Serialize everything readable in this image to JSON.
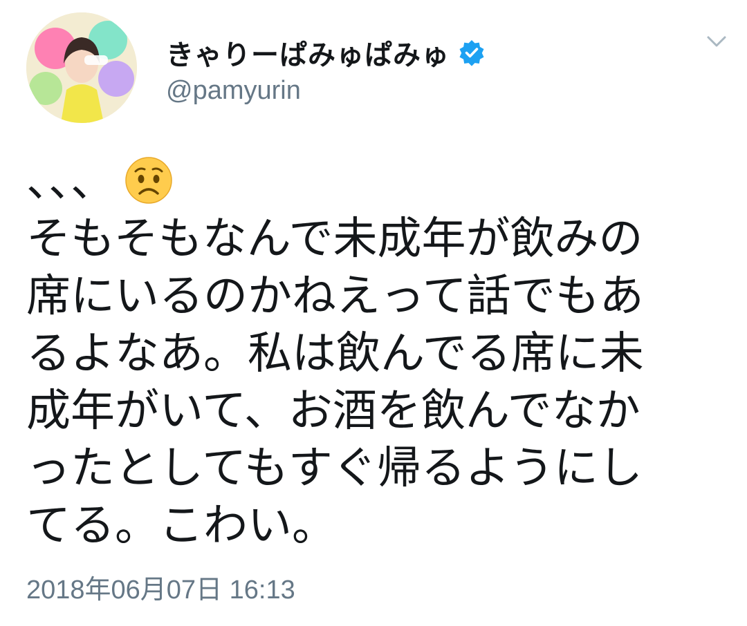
{
  "user": {
    "display_name": "きゃりーぱみゅぱみゅ",
    "handle": "@pamyurin",
    "verified": true,
    "avatar_icon": "profile-photo"
  },
  "tweet": {
    "emoji_icon": "worried-face-emoji",
    "lines": [
      "、、、",
      "そもそもなんで未成年が飲みの",
      "席にいるのかねえって話でもあ",
      "るよなあ。私は飲んでる席に未",
      "成年がいて、お酒を飲んでなか",
      "ったとしてもすぐ帰るようにし",
      "てる。こわい。"
    ],
    "timestamp": "2018年06月07日 16:13"
  },
  "colors": {
    "text": "#14171a",
    "secondary_text": "#657786",
    "verified_badge": "#1da1f2",
    "chevron": "#aab8c2"
  }
}
